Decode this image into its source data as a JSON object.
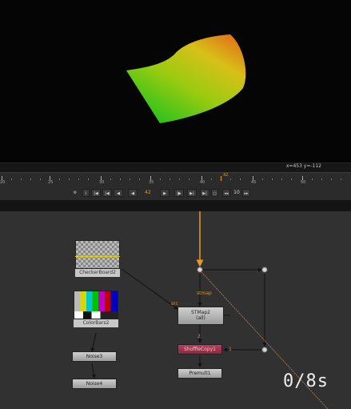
{
  "viewer": {
    "coords": "x=453 y=-112"
  },
  "timeline": {
    "ticks": [
      "20",
      "25",
      "30",
      "35",
      "40",
      "45",
      "50"
    ],
    "current_marker": "42",
    "frame": "42",
    "increment": "10",
    "buttons": {
      "first": "|◀",
      "prev_key": "|◀",
      "step_back": "◀",
      "play_back": "◀",
      "play": "▶",
      "step_fwd": "|▶",
      "next_key": "▶|",
      "last": "▶|",
      "loop": "○",
      "jump_back": "◂◂",
      "jump_fwd": "▸▸"
    }
  },
  "nodes": {
    "checkerboard": "CheckerBoard2",
    "colorbars": "ColorBars2",
    "noise3": "Noise3",
    "noise4": "Noise4",
    "stmap": {
      "name": "STMap2",
      "sub": "(all)"
    },
    "shufflecopy": "ShuffleCopy1",
    "premult": "Premult1"
  },
  "edge_labels": {
    "stmap": "stmap",
    "src": "src",
    "two": "2",
    "one": "1"
  },
  "timer": "0/8s",
  "colors": {
    "accent": "#f0a000",
    "shuffle": "#a0304a",
    "edge": "#d99a3a"
  }
}
